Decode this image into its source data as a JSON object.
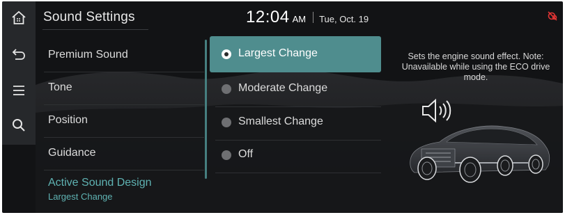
{
  "header": {
    "title": "Sound Settings",
    "time": "12:04",
    "ampm": "AM",
    "date": "Tue, Oct. 19"
  },
  "rail": [
    {
      "icon": "home-icon"
    },
    {
      "icon": "back-icon"
    },
    {
      "icon": "menu-icon"
    },
    {
      "icon": "search-icon"
    }
  ],
  "menu": {
    "items": [
      {
        "label": "Premium Sound"
      },
      {
        "label": "Tone"
      },
      {
        "label": "Position"
      },
      {
        "label": "Guidance"
      },
      {
        "label": "Active Sound Design",
        "sublabel": "Largest Change"
      }
    ]
  },
  "options": {
    "items": [
      {
        "label": "Largest Change",
        "selected": true
      },
      {
        "label": "Moderate Change",
        "selected": false
      },
      {
        "label": "Smallest Change",
        "selected": false
      },
      {
        "label": "Off",
        "selected": false
      }
    ]
  },
  "panel": {
    "description": "Sets the engine sound effect. Note: Unavailable while using the ECO drive mode.",
    "speaker_icon": "speaker-sound-icon",
    "image": "car-illustration"
  },
  "colors": {
    "accent": "#4f8d8e",
    "accent_text": "#5fb3b3",
    "status_icon": "#e03434"
  }
}
